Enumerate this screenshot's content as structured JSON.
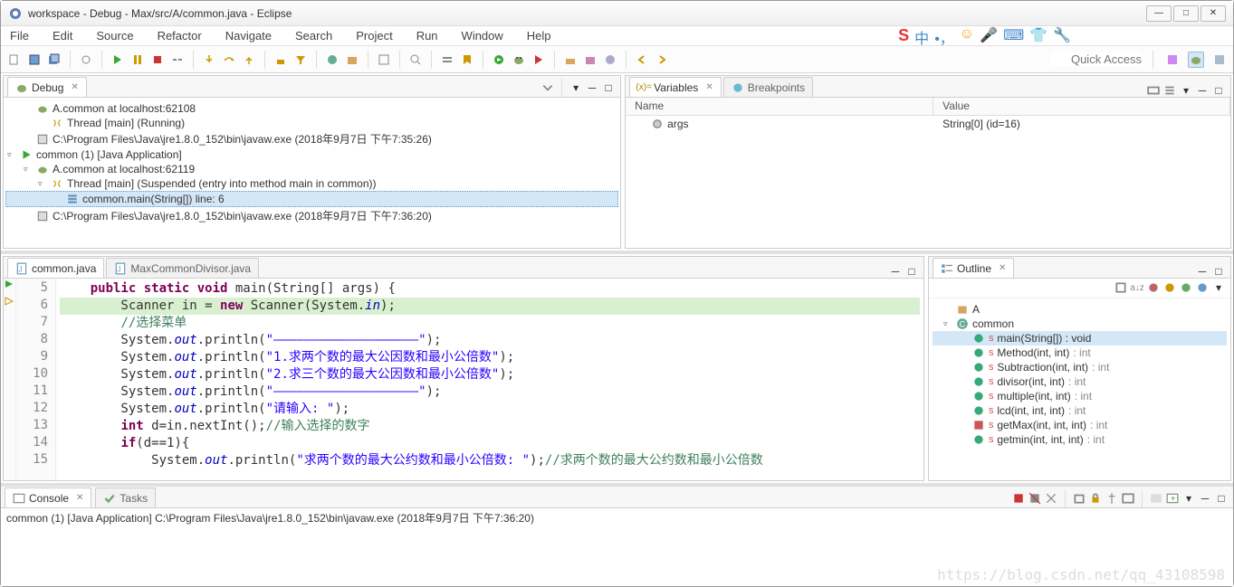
{
  "title": "workspace - Debug - Max/src/A/common.java - Eclipse",
  "menubar": [
    "File",
    "Edit",
    "Source",
    "Refactor",
    "Navigate",
    "Search",
    "Project",
    "Run",
    "Window",
    "Help"
  ],
  "quick_access": "Quick Access",
  "debug": {
    "tab": "Debug",
    "tree": [
      {
        "ind": 1,
        "tw": "",
        "icon": "bug",
        "text": "A.common at localhost:62108"
      },
      {
        "ind": 2,
        "tw": "",
        "icon": "thread",
        "text": "Thread [main] (Running)"
      },
      {
        "ind": 1,
        "tw": "",
        "icon": "proc",
        "text": "C:\\Program Files\\Java\\jre1.8.0_152\\bin\\javaw.exe (2018年9月7日 下午7:35:26)"
      },
      {
        "ind": 0,
        "tw": "▿",
        "icon": "run",
        "text": "common (1) [Java Application]"
      },
      {
        "ind": 1,
        "tw": "▿",
        "icon": "bug",
        "text": "A.common at localhost:62119"
      },
      {
        "ind": 2,
        "tw": "▿",
        "icon": "thread",
        "text": "Thread [main] (Suspended (entry into method main in common))"
      },
      {
        "ind": 3,
        "tw": "",
        "icon": "stack",
        "text": "common.main(String[]) line: 6",
        "sel": true
      },
      {
        "ind": 1,
        "tw": "",
        "icon": "proc",
        "text": "C:\\Program Files\\Java\\jre1.8.0_152\\bin\\javaw.exe (2018年9月7日 下午7:36:20)"
      }
    ]
  },
  "variables": {
    "tab1": "Variables",
    "tab2": "Breakpoints",
    "col1": "Name",
    "col2": "Value",
    "rows": [
      {
        "name": "args",
        "value": "String[0]  (id=16)"
      }
    ]
  },
  "editor": {
    "tab1": "common.java",
    "tab2": "MaxCommonDivisor.java",
    "lines": [
      {
        "n": 5,
        "html": "    <span class='kw'>public static void</span> main(String[] args) {"
      },
      {
        "n": 6,
        "hl": true,
        "html": "        Scanner in = <span class='kw'>new</span> Scanner(System.<span class='fld-it'>in</span>);"
      },
      {
        "n": 7,
        "html": "        <span class='cmt'>//选择菜单</span>"
      },
      {
        "n": 8,
        "html": "        System.<span class='fld-it'>out</span>.println(<span class='str'>\"———————————————————\"</span>);"
      },
      {
        "n": 9,
        "html": "        System.<span class='fld-it'>out</span>.println(<span class='str'>\"1.求两个数的最大公因数和最小公倍数\"</span>);"
      },
      {
        "n": 10,
        "html": "        System.<span class='fld-it'>out</span>.println(<span class='str'>\"2.求三个数的最大公因数和最小公倍数\"</span>);"
      },
      {
        "n": 11,
        "html": "        System.<span class='fld-it'>out</span>.println(<span class='str'>\"———————————————————\"</span>);"
      },
      {
        "n": 12,
        "html": "        System.<span class='fld-it'>out</span>.println(<span class='str'>\"请输入: \"</span>);"
      },
      {
        "n": 13,
        "html": "        <span class='kw'>int</span> d=in.nextInt();<span class='cmt'>//输入选择的数字</span>"
      },
      {
        "n": 14,
        "html": "        <span class='kw'>if</span>(d==1){"
      },
      {
        "n": 15,
        "html": "            System.<span class='fld-it'>out</span>.println(<span class='str'>\"求两个数的最大公约数和最小公倍数: \"</span>);<span class='cmt'>//求两个数的最大公约数和最小公倍数</span>"
      }
    ]
  },
  "outline": {
    "tab": "Outline",
    "items": [
      {
        "ind": 0,
        "icon": "pkg",
        "text": "A"
      },
      {
        "ind": 0,
        "tw": "▿",
        "icon": "class",
        "text": "common"
      },
      {
        "ind": 1,
        "icon": "mpub",
        "text": "main(String[]) : void",
        "sel": true
      },
      {
        "ind": 1,
        "icon": "mpub",
        "text": "Method(int, int)",
        "ret": " : int"
      },
      {
        "ind": 1,
        "icon": "mpub",
        "text": "Subtraction(int, int)",
        "ret": " : int"
      },
      {
        "ind": 1,
        "icon": "mpub",
        "text": "divisor(int, int)",
        "ret": " : int"
      },
      {
        "ind": 1,
        "icon": "mpub",
        "text": "multiple(int, int)",
        "ret": " : int"
      },
      {
        "ind": 1,
        "icon": "mpub",
        "text": "lcd(int, int, int)",
        "ret": " : int"
      },
      {
        "ind": 1,
        "icon": "mpri",
        "text": "getMax(int, int, int)",
        "ret": " : int"
      },
      {
        "ind": 1,
        "icon": "mpub",
        "text": "getmin(int, int, int)",
        "ret": " : int"
      }
    ]
  },
  "console": {
    "tab1": "Console",
    "tab2": "Tasks",
    "line": "common (1) [Java Application] C:\\Program Files\\Java\\jre1.8.0_152\\bin\\javaw.exe (2018年9月7日 下午7:36:20)"
  },
  "watermark": "https://blog.csdn.net/qq_43108598"
}
